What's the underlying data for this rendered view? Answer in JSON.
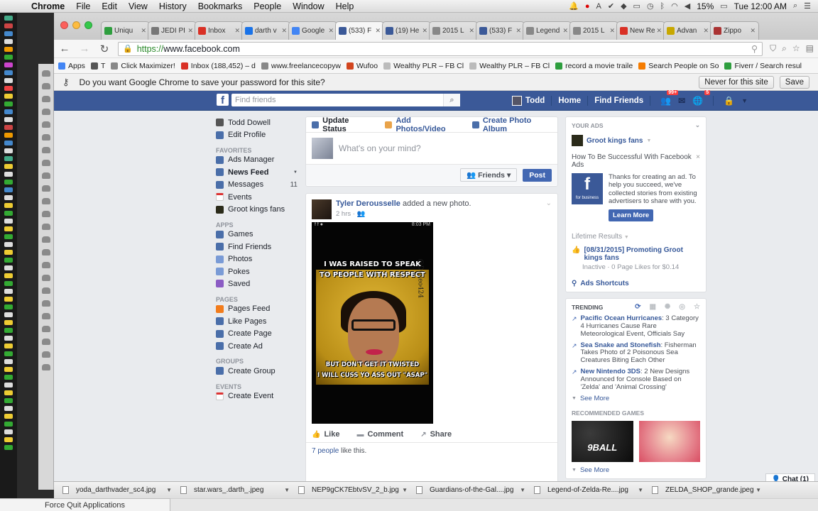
{
  "menubar": {
    "app": "Chrome",
    "items": [
      "File",
      "Edit",
      "View",
      "History",
      "Bookmarks",
      "People",
      "Window",
      "Help"
    ],
    "battery": "15%",
    "clock": "Tue 12:00 AM"
  },
  "tabs": [
    {
      "label": "Uniqu",
      "color": "#2e9e3e"
    },
    {
      "label": "JEDI PI",
      "color": "#777777"
    },
    {
      "label": "Inbox",
      "color": "#d93025"
    },
    {
      "label": "darth v",
      "color": "#1a73e8"
    },
    {
      "label": "Google",
      "color": "#4285f4"
    },
    {
      "label": "(533) F",
      "color": "#3b5998"
    },
    {
      "label": "(19) He",
      "color": "#3b5998"
    },
    {
      "label": "2015 L",
      "color": "#888888"
    },
    {
      "label": "(533) F",
      "color": "#3b5998"
    },
    {
      "label": "Legend",
      "color": "#888888"
    },
    {
      "label": "2015 L",
      "color": "#888888"
    },
    {
      "label": "New Re",
      "color": "#d93025"
    },
    {
      "label": "Advan",
      "color": "#c8a800"
    },
    {
      "label": "Zippo",
      "color": "#a33"
    }
  ],
  "omnibox": {
    "scheme": "https://",
    "host": "www.facebook.com"
  },
  "bookmarks": [
    {
      "label": "Apps",
      "color": "#4285f4"
    },
    {
      "label": "T",
      "color": "#555555"
    },
    {
      "label": "Click Maximizer!",
      "color": "#888888"
    },
    {
      "label": "Inbox (188,452) – d",
      "color": "#d93025"
    },
    {
      "label": "www.freelancecopyw",
      "color": "#888888"
    },
    {
      "label": "Wufoo",
      "color": "#d2451e"
    },
    {
      "label": "Wealthy PLR – FB Cl",
      "color": "#bbbbbb"
    },
    {
      "label": "Wealthy PLR – FB Cl",
      "color": "#bbbbbb"
    },
    {
      "label": "record a movie traile",
      "color": "#2e9e3e"
    },
    {
      "label": "Search People on So",
      "color": "#f57c00"
    },
    {
      "label": "Fiverr / Search resul",
      "color": "#2e9e3e"
    }
  ],
  "infobar": {
    "message": "Do you want Google Chrome to save your password for this site?",
    "never_label": "Never for this site",
    "save_label": "Save"
  },
  "fb": {
    "logo": "f",
    "search_placeholder": "Find friends",
    "nav": {
      "user": "Todd",
      "home": "Home",
      "find_friends": "Find Friends",
      "friend_badge": "99+",
      "notif_badge": "5"
    },
    "left_nav": {
      "profile_name": "Todd Dowell",
      "edit_profile": "Edit Profile",
      "favorites_header": "FAVORITES",
      "ads_manager": "Ads Manager",
      "news_feed": "News Feed",
      "messages": "Messages",
      "messages_count": "11",
      "events": "Events",
      "groot": "Groot kings fans",
      "apps_header": "APPS",
      "games": "Games",
      "find_friends": "Find Friends",
      "photos": "Photos",
      "pokes": "Pokes",
      "saved": "Saved",
      "pages_header": "PAGES",
      "pages_feed": "Pages Feed",
      "like_pages": "Like Pages",
      "create_page": "Create Page",
      "create_ad": "Create Ad",
      "groups_header": "GROUPS",
      "create_group": "Create Group",
      "events_header": "EVENTS",
      "create_event": "Create Event"
    },
    "composer": {
      "update_status": "Update Status",
      "add_photos": "Add Photos/Video",
      "create_album": "Create Photo Album",
      "placeholder": "What's on your mind?",
      "audience": "Friends",
      "post": "Post"
    },
    "story": {
      "author": "Tyler Derousselle",
      "action": " added a new photo.",
      "time": "2 hrs",
      "phone_time": "8:03 PM",
      "meme_top1": "I WAS RAISED TO SPEAK",
      "meme_top2": "TO PEOPLE WITH RESPECT",
      "meme_bottom1": "BUT DON'T GET IT TWISTED",
      "meme_bottom2": "I WILL CUSS YO ASS OUT \"ASAP\"",
      "meme_tag": "@Dukeo424",
      "like": "Like",
      "comment": "Comment",
      "share": "Share",
      "likes_count": "7 people",
      "likes_suffix": " like this."
    },
    "right": {
      "your_ads": "YOUR ADS",
      "page_name": "Groot kings fans",
      "ad_headline": "How To Be Successful With Facebook Ads",
      "ad_logo_sub": "for business",
      "ad_text": "Thanks for creating an ad. To help you succeed, we've collected stories from existing advertisers to share with you.",
      "learn_more": "Learn More",
      "lifetime": "Lifetime Results",
      "promo": "[08/31/2015] Promoting Groot kings fans",
      "promo_sub": "Inactive · 0 Page Likes for $0.14",
      "shortcuts": "Ads Shortcuts",
      "trending": "TRENDING",
      "trends": [
        {
          "topic": "Pacific Ocean Hurricanes",
          "text": ": 3 Category 4 Hurricanes Cause Rare Meteorological Event, Officials Say"
        },
        {
          "topic": "Sea Snake and Stonefish",
          "text": ": Fisherman Takes Photo of 2 Poisonous Sea Creatures Biting Each Other"
        },
        {
          "topic": "New Nintendo 3DS",
          "text": ": 2 New Designs Announced for Console Based on 'Zelda' and 'Animal Crossing'"
        }
      ],
      "see_more": "See More",
      "recommended_games": "RECOMMENDED GAMES",
      "game1": "9BALL",
      "see_more2": "See More",
      "chat": "Chat (1)"
    }
  },
  "downloads": [
    "yoda_darthvader_sc4.jpg",
    "star.wars_.darth_.jpeg",
    "NEP9gCK7EbtvSV_2_b.jpg",
    "Guardians-of-the-Gal....jpg",
    "Legend-of-Zelda-Re....jpg",
    "ZELDA_SHOP_grande.jpeg"
  ],
  "forcequit": "Force Quit Applications"
}
